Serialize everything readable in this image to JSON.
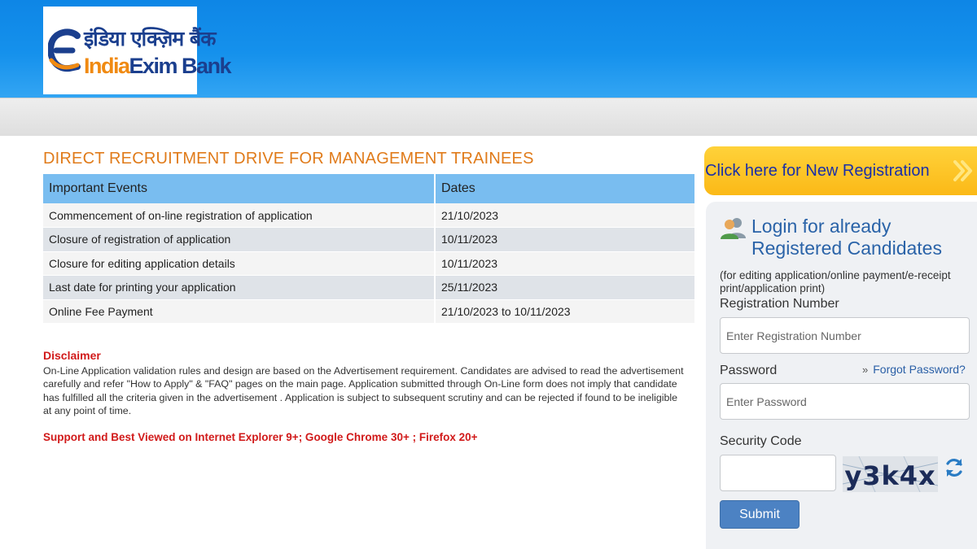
{
  "header": {
    "logo": {
      "hindi_text": "इंडिया एक्ज़िम बैंक",
      "english_part1": "India",
      "english_part2": "Exim Bank"
    }
  },
  "main": {
    "title": "DIRECT RECRUITMENT DRIVE FOR MANAGEMENT TRAINEES",
    "table": {
      "headers": [
        "Important Events",
        "Dates"
      ],
      "rows": [
        {
          "event": "Commencement of on-line registration of application",
          "date": "21/10/2023"
        },
        {
          "event": "Closure of registration of application",
          "date": "10/11/2023"
        },
        {
          "event": "Closure for editing application details",
          "date": "10/11/2023"
        },
        {
          "event": "Last date for printing your application",
          "date": "25/11/2023"
        },
        {
          "event": "Online Fee Payment",
          "date": "21/10/2023 to 10/11/2023"
        }
      ]
    },
    "disclaimer": {
      "title": "Disclaimer",
      "text": "On-Line Application validation rules and design are based on the Advertisement requirement. Candidates are advised to read the advertisement carefully and refer \"How to Apply\" & \"FAQ\" pages on the main page. Application submitted through On-Line form does not imply that candidate has fulfilled all the criteria given in the advertisement . Application is subject to subsequent scrutiny and can be rejected if found to be ineligible at any point of time."
    },
    "support_note": "Support and Best Viewed on Internet Explorer 9+; Google Chrome 30+ ; Firefox 20+"
  },
  "sidebar": {
    "new_registration_label": "Click here for New Registration",
    "login": {
      "title": "Login for already Registered Candidates",
      "note": "(for editing application/online payment/e-receipt print/application print)",
      "registration_label": "Registration Number",
      "registration_placeholder": "Enter Registration Number",
      "password_label": "Password",
      "password_placeholder": "Enter Password",
      "forgot_chevron": "»",
      "forgot_label": "Forgot Password?",
      "security_label": "Security Code",
      "captcha_text": "y3k4x",
      "submit_label": "Submit"
    }
  },
  "colors": {
    "header_blue": "#1591ec",
    "title_orange": "#e07b1a",
    "table_header": "#79bdf0",
    "alert_red": "#d11a1a",
    "registration_yellow": "#fbb917",
    "link_blue": "#2a63a8",
    "submit_blue": "#4c82c3"
  },
  "icons": {
    "logo_mark": "exim-e-logo-icon",
    "arrow": "double-chevron-right-icon",
    "users": "users-icon",
    "refresh": "refresh-icon"
  }
}
